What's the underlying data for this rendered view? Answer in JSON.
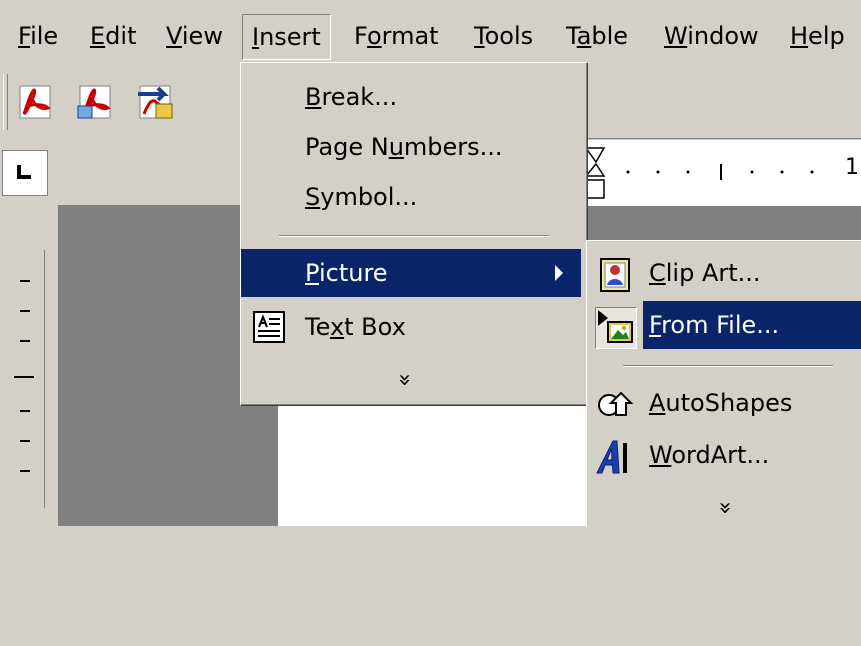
{
  "menubar": {
    "items": [
      {
        "pre": "",
        "acc": "F",
        "post": "ile"
      },
      {
        "pre": "",
        "acc": "E",
        "post": "dit"
      },
      {
        "pre": "",
        "acc": "V",
        "post": "iew"
      },
      {
        "pre": "",
        "acc": "I",
        "post": "nsert"
      },
      {
        "pre": "F",
        "acc": "o",
        "post": "rmat"
      },
      {
        "pre": "",
        "acc": "T",
        "post": "ools"
      },
      {
        "pre": "T",
        "acc": "a",
        "post": "ble"
      },
      {
        "pre": "",
        "acc": "W",
        "post": "indow"
      },
      {
        "pre": "",
        "acc": "H",
        "post": "elp"
      }
    ]
  },
  "toolbar": {
    "icons": [
      "pdf-convert-icon",
      "pdf-convert-and-email-icon",
      "pdf-convert-and-review-icon"
    ]
  },
  "ruler": {
    "number": "1"
  },
  "insert_menu": {
    "items": [
      {
        "pre": "",
        "acc": "B",
        "post": "reak..."
      },
      {
        "pre": "Page N",
        "acc": "u",
        "post": "mbers..."
      },
      {
        "pre": "",
        "acc": "S",
        "post": "ymbol..."
      },
      {
        "pre": "",
        "acc": "P",
        "post": "icture"
      },
      {
        "pre": "Te",
        "acc": "x",
        "post": "t Box"
      }
    ],
    "more": "»"
  },
  "picture_submenu": {
    "items": [
      {
        "pre": "",
        "acc": "C",
        "post": "lip Art..."
      },
      {
        "pre": "",
        "acc": "F",
        "post": "rom File..."
      },
      {
        "pre": "",
        "acc": "A",
        "post": "utoShapes"
      },
      {
        "pre": "",
        "acc": "W",
        "post": "ordArt..."
      }
    ],
    "more": "»"
  },
  "colors": {
    "face": "#d4d0c8",
    "highlight": "#0a246a",
    "shadow": "#808080",
    "pdf_red": "#cc0000"
  }
}
